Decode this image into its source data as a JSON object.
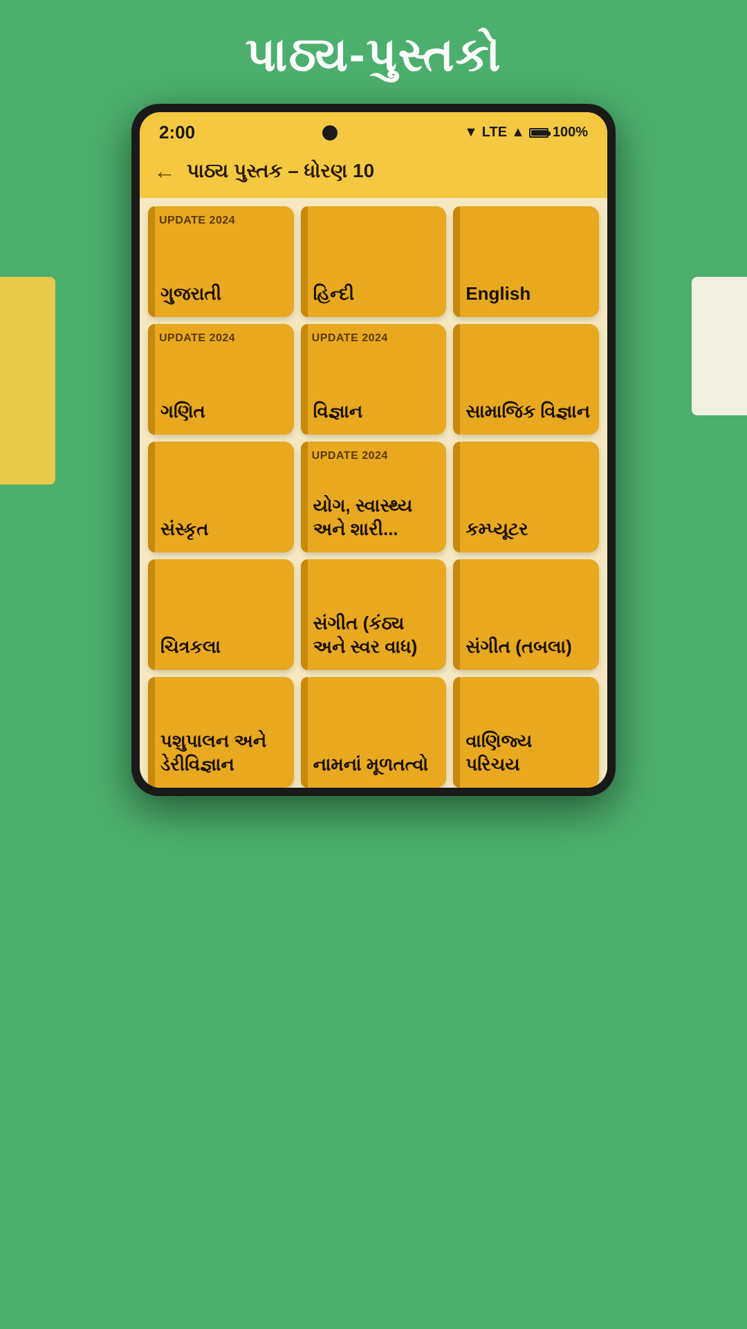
{
  "page": {
    "title": "પાઠ્ય-પુસ્તકો",
    "background_color": "#4caf6e"
  },
  "status_bar": {
    "time": "2:00",
    "signal": "LTE",
    "battery": "100%"
  },
  "nav": {
    "title": "પાઠ્ય પુસ્તક  – ધોરણ 10",
    "back_label": "←"
  },
  "subjects": [
    {
      "id": 1,
      "name": "ગુજરાતી",
      "update": "UPDATE 2024",
      "has_update": true
    },
    {
      "id": 2,
      "name": "હિન્દી",
      "update": "",
      "has_update": false
    },
    {
      "id": 3,
      "name": "English",
      "update": "",
      "has_update": false
    },
    {
      "id": 4,
      "name": "ગણિત",
      "update": "UPDATE 2024",
      "has_update": true
    },
    {
      "id": 5,
      "name": "વિજ્ઞાન",
      "update": "UPDATE 2024",
      "has_update": true
    },
    {
      "id": 6,
      "name": "સામાજિક વિજ્ઞાન",
      "update": "",
      "has_update": false
    },
    {
      "id": 7,
      "name": "સંસ્કૃત",
      "update": "",
      "has_update": false
    },
    {
      "id": 8,
      "name": "યોગ, સ્વાસ્થ્ય અને શારી...",
      "update": "UPDATE 2024",
      "has_update": true
    },
    {
      "id": 9,
      "name": "કમ્પ્યૂટર",
      "update": "",
      "has_update": false
    },
    {
      "id": 10,
      "name": "ચિત્રકલા",
      "update": "",
      "has_update": false
    },
    {
      "id": 11,
      "name": "સંગીત (કંઠ્ય અને સ્વર વાધ)",
      "update": "",
      "has_update": false
    },
    {
      "id": 12,
      "name": "સંગીત (તબલા)",
      "update": "",
      "has_update": false
    },
    {
      "id": 13,
      "name": "પશુપાલન અને ડેરીવિજ્ઞાન",
      "update": "",
      "has_update": false
    },
    {
      "id": 14,
      "name": "નામનાં મૂળતત્વો",
      "update": "",
      "has_update": false
    },
    {
      "id": 15,
      "name": "વાણિજ્ય પરિચય",
      "update": "",
      "has_update": false
    }
  ],
  "update_label": "UPDATE 2024"
}
